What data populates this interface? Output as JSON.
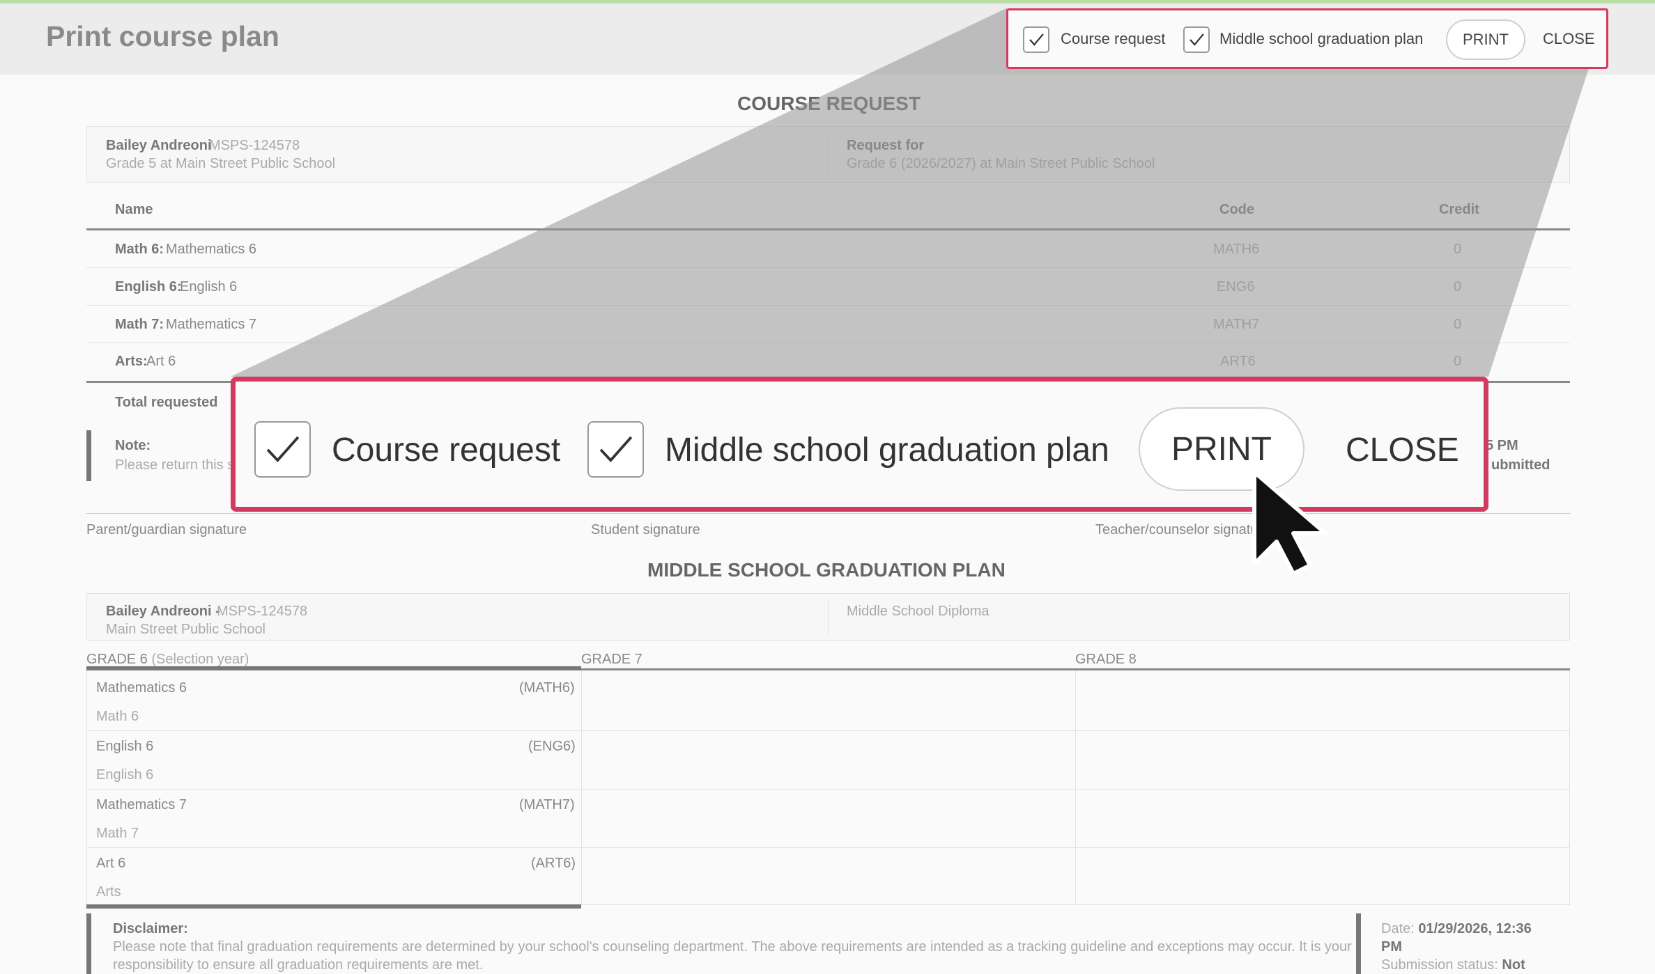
{
  "header": {
    "title": "Print course plan",
    "controls": {
      "course_request_label": "Course request",
      "graduation_plan_label": "Middle school graduation plan",
      "print_label": "PRINT",
      "close_label": "CLOSE"
    }
  },
  "course_request": {
    "title": "COURSE REQUEST",
    "student_name": "Bailey Andreoni",
    "student_id": "MSPS-124578",
    "student_grade": "Grade 5 at Main Street Public School",
    "request_for_label": "Request for",
    "request_for_value": "Grade 6 (2026/2027) at Main Street Public School",
    "columns": [
      "Name",
      "Code",
      "Credit"
    ],
    "rows": [
      {
        "subject": "Math 6:",
        "course": "Mathematics 6",
        "code": "MATH6",
        "credit": "0"
      },
      {
        "subject": "English 6:",
        "course": "English 6",
        "code": "ENG6",
        "credit": "0"
      },
      {
        "subject": "Math 7:",
        "course": "Mathematics 7",
        "code": "MATH7",
        "credit": "0"
      },
      {
        "subject": "Arts:",
        "course": "Art 6",
        "code": "ART6",
        "credit": "0"
      }
    ],
    "total_label": "Total requested",
    "note_label": "Note:",
    "note_text": "Please return this s",
    "note_right_1": "5 PM",
    "note_right_2": "ubmitted",
    "signatures": [
      "Parent/guardian signature",
      "Student signature",
      "Teacher/counselor signature"
    ]
  },
  "graduation_plan": {
    "title": "MIDDLE SCHOOL GRADUATION PLAN",
    "student_name": "Bailey Andreoni -",
    "student_id": "MSPS-124578",
    "school": "Main Street Public School",
    "diploma": "Middle School Diploma",
    "grade6_label": "GRADE 6",
    "grade6_note": "(Selection year)",
    "grade7_label": "GRADE 7",
    "grade8_label": "GRADE 8",
    "courses": [
      {
        "name": "Mathematics 6",
        "code": "(MATH6)",
        "sub": "Math 6"
      },
      {
        "name": "English 6",
        "code": "(ENG6)",
        "sub": "English 6"
      },
      {
        "name": "Mathematics 7",
        "code": "(MATH7)",
        "sub": "Math 7"
      },
      {
        "name": "Art 6",
        "code": "(ART6)",
        "sub": "Arts"
      }
    ],
    "disclaimer_label": "Disclaimer:",
    "disclaimer_line1": "Please note that final graduation requirements are determined by your school's counseling department. The above requirements are intended as a tracking guideline and exceptions may occur. It is your",
    "disclaimer_line2": "responsibility to ensure all graduation requirements are met.",
    "date_label": "Date:",
    "date_value": "01/29/2026, 12:36",
    "date_value_2": "PM",
    "status_label": "Submission status:",
    "status_value": "Not"
  },
  "zoom": {
    "course_request_label": "Course request",
    "graduation_plan_label": "Middle school graduation plan",
    "print_label": "PRINT",
    "close_label": "CLOSE"
  },
  "colors": {
    "highlight": "#d23a5f",
    "accent_bar": "#b9dfa5"
  },
  "icons": [
    "check-icon",
    "mouse-pointer-icon"
  ]
}
